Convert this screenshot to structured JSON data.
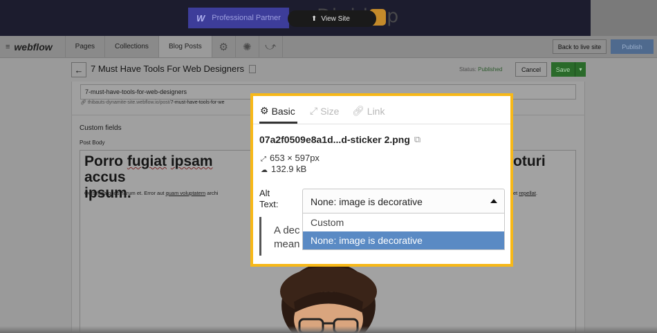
{
  "banner": {
    "partner_logo": "W",
    "partner_label": "Professional Partner",
    "view_site_label": "View Site",
    "brand_left": "Digid",
    "brand_right": "p"
  },
  "nav": {
    "logo": "webflow",
    "tabs": [
      "Pages",
      "Collections",
      "Blog Posts"
    ],
    "active_tab": "Blog Posts",
    "back_to_live": "Back to live site",
    "publish": "Publish"
  },
  "subheader": {
    "title": "7 Must Have Tools For Web Designers",
    "status_label": "Status:",
    "status_value": "Published",
    "cancel": "Cancel",
    "save": "Save"
  },
  "editor": {
    "slug_value": "7-must-have-tools-for-web-designers",
    "slug_url_prefix": "thibauts-dynamite-site.webflow.io/post/",
    "slug_url_suffix": "7-must-have-tools-for-we",
    "custom_fields_label": "Custom fields",
    "post_body_label": "Post Body",
    "heading_line1_a": "Porro ",
    "heading_line1_b": "fugiat",
    "heading_line1_c": " ",
    "heading_line1_d": "ipsam",
    "heading_line1_e": " accus",
    "heading_line2": "ipsum.",
    "heading_right": "oturi",
    "para_left_a": "Quis fuga quos harum et. Error aut ",
    "para_left_b": "quam voluptatem",
    "para_left_c": " archi",
    "para_right_a": "et ",
    "para_right_b": "repellat",
    "para_right_c": "."
  },
  "modal": {
    "tabs": {
      "basic": "Basic",
      "size": "Size",
      "link": "Link"
    },
    "filename": "07a2f0509e8a1d...d-sticker 2.png",
    "dimensions": "653 × 597px",
    "filesize": "132.9 kB",
    "alt_label": "Alt Text:",
    "alt_selected": "None: image is decorative",
    "alt_options": [
      "Custom",
      "None: image is decorative"
    ],
    "description_partial_line1": "A dec",
    "description_partial_line2": "mean"
  },
  "colors": {
    "modal_border": "#f7b818",
    "option_selected": "#5a8ac4",
    "save_button": "#2a6a2a",
    "publish_button": "#4f6a8e"
  },
  "icons": {
    "basic_tab": "gear-icon",
    "size_tab": "resize-icon",
    "link_tab": "link-icon",
    "external": "external-link-icon",
    "dimensions": "resize-icon",
    "filesize": "cloud-icon",
    "dropdown": "caret-up-icon"
  }
}
